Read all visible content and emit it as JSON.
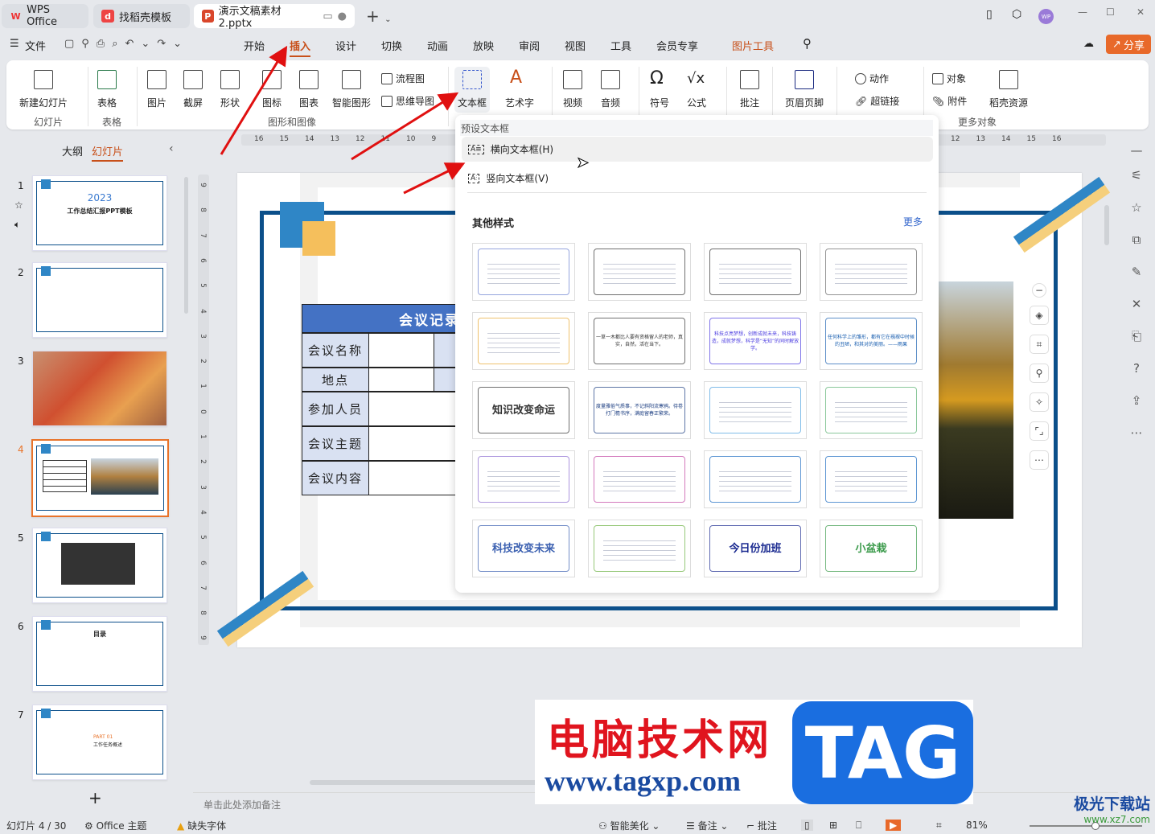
{
  "tabs": [
    {
      "label": "WPS Office",
      "icon": "wps-logo-icon"
    },
    {
      "label": "找稻壳模板",
      "icon": "docer-logo-icon"
    },
    {
      "label": "演示文稿素材2.pptx",
      "icon": "ppt-file-icon"
    }
  ],
  "menu": {
    "file": "文件",
    "items": [
      "开始",
      "插入",
      "设计",
      "切换",
      "动画",
      "放映",
      "审阅",
      "视图",
      "工具",
      "会员专享"
    ],
    "active": "插入",
    "context_tab": "图片工具",
    "share": "分享",
    "avatar": "WP"
  },
  "ribbon": {
    "new_slide": "新建幻灯片",
    "table": "表格",
    "picture": "图片",
    "screenshot": "截屏",
    "shape": "形状",
    "icon": "图标",
    "chart": "图表",
    "smartart": "智能图形",
    "flowchart": "流程图",
    "mindmap": "思维导图",
    "textbox": "文本框",
    "wordart": "艺术字",
    "video": "视频",
    "audio": "音频",
    "symbol": "符号",
    "formula": "公式",
    "comment": "批注",
    "header_footer": "页眉页脚",
    "action": "动作",
    "hyperlink": "超链接",
    "object": "对象",
    "attachment": "附件",
    "docer": "稻壳资源",
    "groups": {
      "slides": "幻灯片",
      "table": "表格",
      "shapes": "图形和图像",
      "more": "更多对象"
    }
  },
  "left_panel": {
    "tabs": [
      "大纲",
      "幻灯片"
    ],
    "active": "幻灯片",
    "slides": [
      "1",
      "2",
      "3",
      "4",
      "5",
      "6",
      "7"
    ],
    "selected": "4",
    "slide1_year": "2023",
    "slide1_title": "工作总结汇报PPT模板",
    "slide6_title": "目录",
    "slide7_part": "PART 01",
    "slide7_sub": "工作任务概述"
  },
  "ruler_h": [
    "16",
    "15",
    "14",
    "13",
    "12",
    "11",
    "10",
    "9",
    "12",
    "13",
    "14",
    "15",
    "16"
  ],
  "ruler_v": [
    "9",
    "8",
    "7",
    "6",
    "5",
    "4",
    "3",
    "2",
    "1",
    "0",
    "1",
    "2",
    "3",
    "4",
    "5",
    "6",
    "7",
    "8",
    "9"
  ],
  "slide": {
    "table_title": "会议记录",
    "rows": [
      "会议名称",
      "地点",
      "参加人员",
      "会议主题",
      "会议内容"
    ]
  },
  "dropdown": {
    "preset_title": "预设文本框",
    "horizontal": "横向文本框(H)",
    "vertical": "竖向文本框(V)",
    "other_title": "其他样式",
    "more": "更多",
    "gallery": [
      {
        "text": "",
        "color": "#6a7fd0"
      },
      {
        "text": "",
        "color": "#333"
      },
      {
        "text": "",
        "color": "#333"
      },
      {
        "text": "",
        "color": "#666"
      },
      {
        "text": "",
        "color": "#e8a830"
      },
      {
        "text": "一草一木都比人要有资格留人的老师，真实，自然，活在当下。",
        "color": "#333"
      },
      {
        "text": "科技点亮梦想，创新成就未来，科技铸造，成就梦想，科学是“无知”的同时解放学。",
        "color": "#4a3be0"
      },
      {
        "text": "任何科学上的雏形，都有它在襁褓中时候的丑陋，和其对的美丽。——雨果",
        "color": "#1a5fb0"
      },
      {
        "text": "知识改变命运",
        "color": "#333"
      },
      {
        "text": "度量雅俗气质事，不记斜阳流寒鸦。待卷打门檐书序，满庭留春正繁荣。",
        "color": "#1a3c80"
      },
      {
        "text": "",
        "color": "#4aa0e0"
      },
      {
        "text": "",
        "color": "#5ab070"
      },
      {
        "text": "",
        "color": "#8a6ad0"
      },
      {
        "text": "",
        "color": "#c040a0"
      },
      {
        "text": "",
        "color": "#1a6ac0"
      },
      {
        "text": "",
        "color": "#1a6ac0"
      },
      {
        "text": "科技改变未来",
        "color": "#3a5fb0"
      },
      {
        "text": "",
        "color": "#6ab040"
      },
      {
        "text": "今日份加班",
        "color": "#1a2a90"
      },
      {
        "text": "小盆栽",
        "color": "#3a9a4a"
      }
    ]
  },
  "notes_placeholder": "单击此处添加备注",
  "status": {
    "slide": "幻灯片 4 / 30",
    "theme": "Office 主题",
    "missing_font": "缺失字体",
    "beautify": "智能美化",
    "notes": "备注",
    "comment": "批注",
    "zoom": "81%",
    "zoom_percent": 81
  },
  "watermark": {
    "cn": "电脑技术网",
    "url": "www.tagxp.com",
    "tag": "TAG",
    "site2": "极光下载站",
    "site2_url": "www.xz7.com"
  },
  "colors": {
    "accent": "#c8501a",
    "share": "#e8692a",
    "frame": "#0b4f8a",
    "table_header": "#4472c4",
    "table_label": "#d9e1f2"
  }
}
